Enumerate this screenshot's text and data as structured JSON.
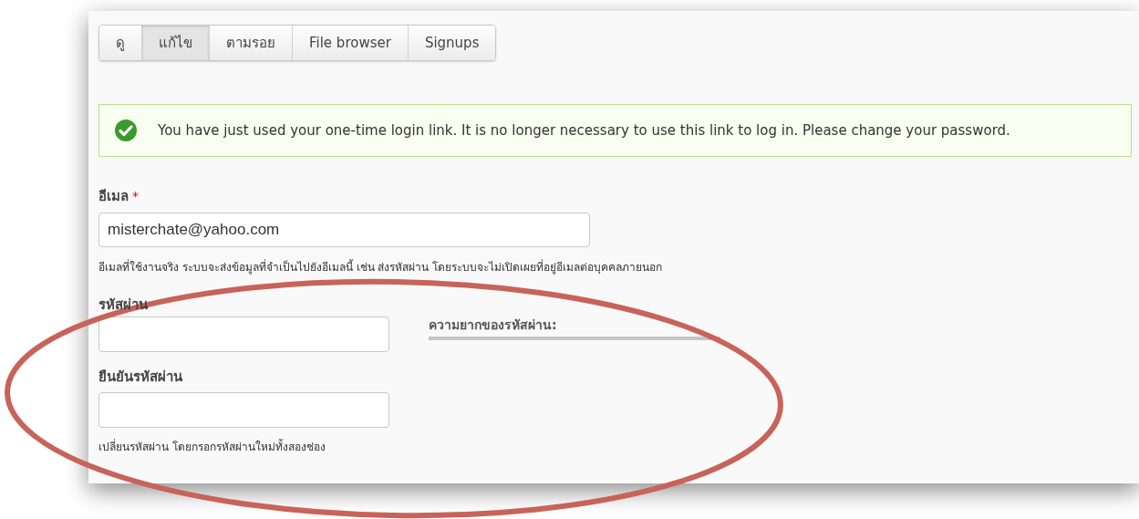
{
  "tabs": [
    {
      "label": "ดู",
      "selected": false
    },
    {
      "label": "แก้ไข",
      "selected": true
    },
    {
      "label": "ตามรอย",
      "selected": false
    },
    {
      "label": "File browser",
      "selected": false
    },
    {
      "label": "Signups",
      "selected": false
    }
  ],
  "status_message": {
    "kind": "success",
    "text": "You have just used your one-time login link. It is no longer necessary to use this link to log in. Please change your password."
  },
  "email": {
    "label": "อีเมล",
    "required": true,
    "required_mark": "*",
    "value": "misterchate@yahoo.com",
    "description": "อีเมลที่ใช้งานจริง ระบบจะส่งข้อมูลที่จำเป็นไปยังอีเมลนี้ เช่น ส่งรหัสผ่าน โดยระบบจะไม่เปิดเผยที่อยู่อีเมลต่อบุคคลภายนอก"
  },
  "password": {
    "label": "รหัสผ่าน",
    "strength_label": "ความยากของรหัสผ่าน:",
    "level": 0
  },
  "confirm_password": {
    "label": "ยืนยันรหัสผ่าน",
    "description": "เปลี่ยนรหัสผ่าน โดยกรอกรหัสผ่านใหม่ทั้งสองช่อง"
  }
}
